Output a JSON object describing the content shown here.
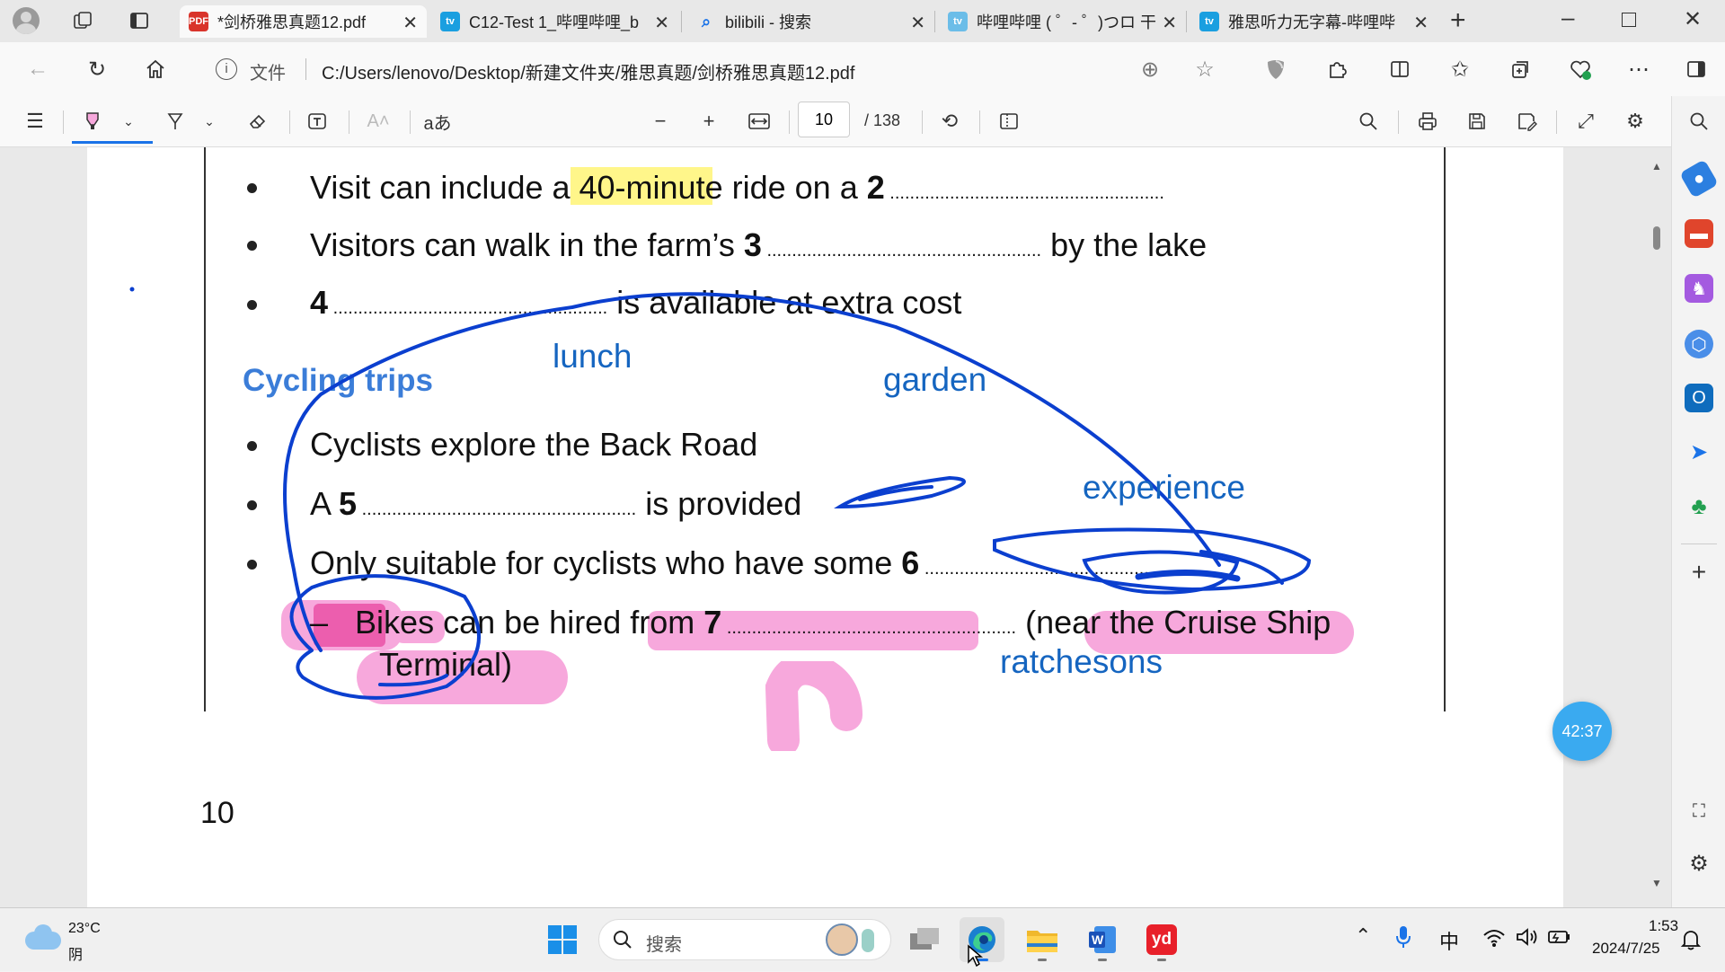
{
  "browser": {
    "tabs": [
      {
        "label": "*剑桥雅思真题12.pdf",
        "active": true
      },
      {
        "label": "C12-Test 1_哔哩哔哩_b",
        "active": false
      },
      {
        "label": "bilibili - 搜索",
        "active": false
      },
      {
        "label": "哔哩哔哩 ( ゜- ゜)つロ 干",
        "active": false
      },
      {
        "label": "雅思听力无字幕-哔哩哔",
        "active": false
      }
    ],
    "address": {
      "scheme_label": "文件",
      "url": "C:/Users/lenovo/Desktop/新建文件夹/雅思真题/剑桥雅思真题12.pdf"
    }
  },
  "pdf_toolbar": {
    "read_aloud_label": "aあ",
    "page_number": "10",
    "page_total": "/ 138"
  },
  "document": {
    "lines": [
      {
        "before": "Visit can include a ",
        "highlight": "40-minute",
        "after": " ride on a ",
        "num": "2",
        "tail": ""
      },
      {
        "before": "Visitors can walk in the farm’s ",
        "num": "3",
        "tail": " by the lake"
      },
      {
        "num": "4",
        "tail": " is available at extra cost"
      }
    ],
    "section_heading": "Cycling trips",
    "cycling_lines": [
      {
        "text": "Cyclists explore the Back Road"
      },
      {
        "before": "A ",
        "num": "5",
        "tail": " is provided"
      },
      {
        "before": "Only suitable for cyclists who have some ",
        "num": "6",
        "tail": ""
      }
    ],
    "dash_line": {
      "dash": "–",
      "before": "Bikes can be hired from ",
      "num": "7",
      "tail": " (near the Cruise Ship",
      "wrap": "Terminal)"
    },
    "page_footer": "10",
    "handwritten": {
      "lunch": "lunch",
      "garden": "garden",
      "experience": "experience",
      "ratchesons": "ratchesons"
    }
  },
  "timer_badge": "42:37",
  "taskbar": {
    "weather_temp": "23°C",
    "weather_desc": "阴",
    "search_placeholder": "搜索",
    "ime": "中",
    "time": "1:53",
    "date": "2024/7/25"
  },
  "colors": {
    "ink_blue": "#0b3fcf",
    "highlight_pink": "#f7a8dc",
    "highlight_yellow": "#fff68a",
    "heading_blue": "#3b7dd8"
  }
}
